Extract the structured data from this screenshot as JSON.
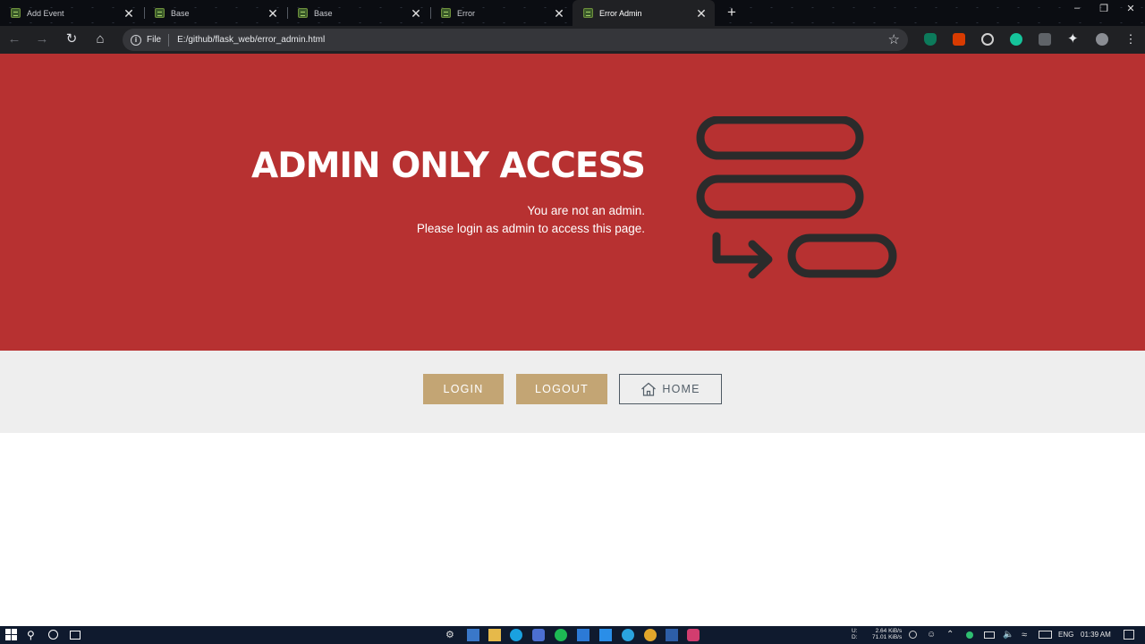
{
  "browser": {
    "tabs": [
      {
        "title": "Add Event",
        "active": false
      },
      {
        "title": "Base",
        "active": false
      },
      {
        "title": "Base",
        "active": false
      },
      {
        "title": "Error",
        "active": false
      },
      {
        "title": "Error Admin",
        "active": true
      }
    ],
    "new_tab_glyph": "+",
    "close_glyph": "✕",
    "address": {
      "scheme_label": "File",
      "url": "E:/github/flask_web/error_admin.html"
    }
  },
  "hero": {
    "title": "ADMIN ONLY ACCESS",
    "line1": "You are not an admin.",
    "line2": "Please login as admin to access this page.",
    "background": "#b73131",
    "icon_color": "#2b2b2b"
  },
  "actions": {
    "login_label": "LOGIN",
    "logout_label": "LOGOUT",
    "home_label": "HOME",
    "gold": "#c3a574"
  },
  "taskbar": {
    "net_up_prefix": "U:",
    "net_down_prefix": "D:",
    "net_up": "2.64 KiB/s",
    "net_down": "71.01 KiB/s",
    "lang": "ENG",
    "time": "01:39 AM"
  }
}
